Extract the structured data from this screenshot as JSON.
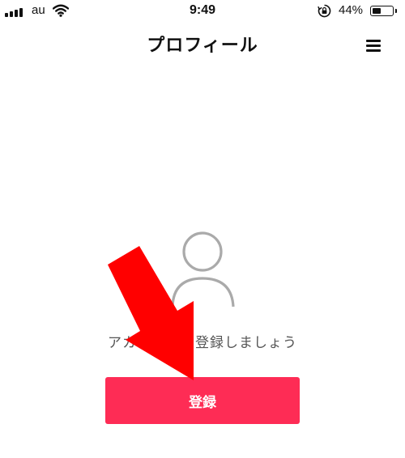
{
  "status_bar": {
    "carrier": "au",
    "time": "9:49",
    "battery_percent": "44%",
    "battery_level": 0.44,
    "icons": [
      "signal-bars-icon",
      "wifi-icon",
      "rotation-lock-icon",
      "battery-icon"
    ]
  },
  "nav": {
    "title": "プロフィール",
    "menu_icon": "hamburger-menu-icon"
  },
  "main": {
    "avatar_icon": "person-outline-icon",
    "prompt": "アカウントを登録しましょう",
    "register_label": "登録"
  },
  "annotation": {
    "arrow_color": "#ff0000",
    "arrow_icon": "red-arrow-icon"
  },
  "colors": {
    "accent": "#fe2c55",
    "text": "#111111",
    "muted_text": "#555555",
    "avatar_stroke": "#aaaaaa"
  }
}
